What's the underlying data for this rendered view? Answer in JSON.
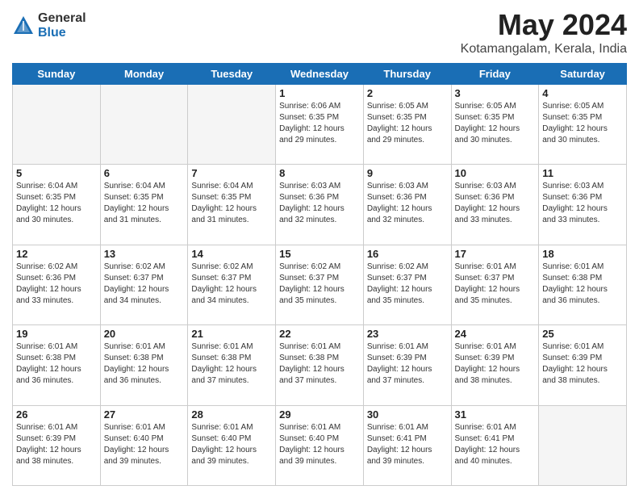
{
  "logo": {
    "general": "General",
    "blue": "Blue"
  },
  "title": "May 2024",
  "subtitle": "Kotamangalam, Kerala, India",
  "days_of_week": [
    "Sunday",
    "Monday",
    "Tuesday",
    "Wednesday",
    "Thursday",
    "Friday",
    "Saturday"
  ],
  "weeks": [
    [
      {
        "day": "",
        "info": ""
      },
      {
        "day": "",
        "info": ""
      },
      {
        "day": "",
        "info": ""
      },
      {
        "day": "1",
        "info": "Sunrise: 6:06 AM\nSunset: 6:35 PM\nDaylight: 12 hours\nand 29 minutes."
      },
      {
        "day": "2",
        "info": "Sunrise: 6:05 AM\nSunset: 6:35 PM\nDaylight: 12 hours\nand 29 minutes."
      },
      {
        "day": "3",
        "info": "Sunrise: 6:05 AM\nSunset: 6:35 PM\nDaylight: 12 hours\nand 30 minutes."
      },
      {
        "day": "4",
        "info": "Sunrise: 6:05 AM\nSunset: 6:35 PM\nDaylight: 12 hours\nand 30 minutes."
      }
    ],
    [
      {
        "day": "5",
        "info": "Sunrise: 6:04 AM\nSunset: 6:35 PM\nDaylight: 12 hours\nand 30 minutes."
      },
      {
        "day": "6",
        "info": "Sunrise: 6:04 AM\nSunset: 6:35 PM\nDaylight: 12 hours\nand 31 minutes."
      },
      {
        "day": "7",
        "info": "Sunrise: 6:04 AM\nSunset: 6:35 PM\nDaylight: 12 hours\nand 31 minutes."
      },
      {
        "day": "8",
        "info": "Sunrise: 6:03 AM\nSunset: 6:36 PM\nDaylight: 12 hours\nand 32 minutes."
      },
      {
        "day": "9",
        "info": "Sunrise: 6:03 AM\nSunset: 6:36 PM\nDaylight: 12 hours\nand 32 minutes."
      },
      {
        "day": "10",
        "info": "Sunrise: 6:03 AM\nSunset: 6:36 PM\nDaylight: 12 hours\nand 33 minutes."
      },
      {
        "day": "11",
        "info": "Sunrise: 6:03 AM\nSunset: 6:36 PM\nDaylight: 12 hours\nand 33 minutes."
      }
    ],
    [
      {
        "day": "12",
        "info": "Sunrise: 6:02 AM\nSunset: 6:36 PM\nDaylight: 12 hours\nand 33 minutes."
      },
      {
        "day": "13",
        "info": "Sunrise: 6:02 AM\nSunset: 6:37 PM\nDaylight: 12 hours\nand 34 minutes."
      },
      {
        "day": "14",
        "info": "Sunrise: 6:02 AM\nSunset: 6:37 PM\nDaylight: 12 hours\nand 34 minutes."
      },
      {
        "day": "15",
        "info": "Sunrise: 6:02 AM\nSunset: 6:37 PM\nDaylight: 12 hours\nand 35 minutes."
      },
      {
        "day": "16",
        "info": "Sunrise: 6:02 AM\nSunset: 6:37 PM\nDaylight: 12 hours\nand 35 minutes."
      },
      {
        "day": "17",
        "info": "Sunrise: 6:01 AM\nSunset: 6:37 PM\nDaylight: 12 hours\nand 35 minutes."
      },
      {
        "day": "18",
        "info": "Sunrise: 6:01 AM\nSunset: 6:38 PM\nDaylight: 12 hours\nand 36 minutes."
      }
    ],
    [
      {
        "day": "19",
        "info": "Sunrise: 6:01 AM\nSunset: 6:38 PM\nDaylight: 12 hours\nand 36 minutes."
      },
      {
        "day": "20",
        "info": "Sunrise: 6:01 AM\nSunset: 6:38 PM\nDaylight: 12 hours\nand 36 minutes."
      },
      {
        "day": "21",
        "info": "Sunrise: 6:01 AM\nSunset: 6:38 PM\nDaylight: 12 hours\nand 37 minutes."
      },
      {
        "day": "22",
        "info": "Sunrise: 6:01 AM\nSunset: 6:38 PM\nDaylight: 12 hours\nand 37 minutes."
      },
      {
        "day": "23",
        "info": "Sunrise: 6:01 AM\nSunset: 6:39 PM\nDaylight: 12 hours\nand 37 minutes."
      },
      {
        "day": "24",
        "info": "Sunrise: 6:01 AM\nSunset: 6:39 PM\nDaylight: 12 hours\nand 38 minutes."
      },
      {
        "day": "25",
        "info": "Sunrise: 6:01 AM\nSunset: 6:39 PM\nDaylight: 12 hours\nand 38 minutes."
      }
    ],
    [
      {
        "day": "26",
        "info": "Sunrise: 6:01 AM\nSunset: 6:39 PM\nDaylight: 12 hours\nand 38 minutes."
      },
      {
        "day": "27",
        "info": "Sunrise: 6:01 AM\nSunset: 6:40 PM\nDaylight: 12 hours\nand 39 minutes."
      },
      {
        "day": "28",
        "info": "Sunrise: 6:01 AM\nSunset: 6:40 PM\nDaylight: 12 hours\nand 39 minutes."
      },
      {
        "day": "29",
        "info": "Sunrise: 6:01 AM\nSunset: 6:40 PM\nDaylight: 12 hours\nand 39 minutes."
      },
      {
        "day": "30",
        "info": "Sunrise: 6:01 AM\nSunset: 6:41 PM\nDaylight: 12 hours\nand 39 minutes."
      },
      {
        "day": "31",
        "info": "Sunrise: 6:01 AM\nSunset: 6:41 PM\nDaylight: 12 hours\nand 40 minutes."
      },
      {
        "day": "",
        "info": ""
      }
    ]
  ]
}
